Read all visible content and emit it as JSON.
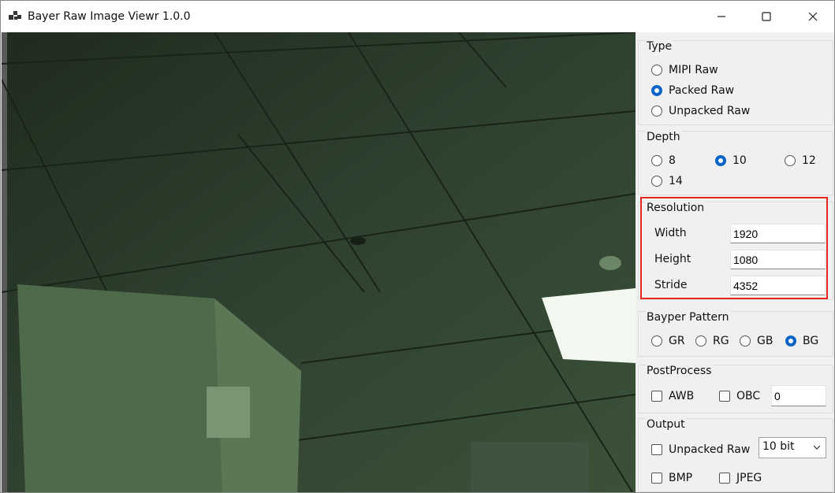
{
  "window": {
    "title": "Bayer Raw Image Viewr 1.0.0",
    "icon": "app-icon",
    "controls": [
      "minimize-icon",
      "maximize-icon",
      "close-icon"
    ]
  },
  "viewer": {
    "content": "green-tinted raw image of an office ceiling"
  },
  "type": {
    "title": "Type",
    "options": [
      {
        "label": "MIPI Raw",
        "selected": false
      },
      {
        "label": "Packed Raw",
        "selected": true
      },
      {
        "label": "Unpacked Raw",
        "selected": false
      }
    ]
  },
  "depth": {
    "title": "Depth",
    "options": [
      {
        "label": "8",
        "selected": false
      },
      {
        "label": "10",
        "selected": true
      },
      {
        "label": "12",
        "selected": false
      },
      {
        "label": "14",
        "selected": false
      }
    ]
  },
  "resolution": {
    "title": "Resolution",
    "width_label": "Width",
    "width_value": "1920",
    "height_label": "Height",
    "height_value": "1080",
    "stride_label": "Stride",
    "stride_value": "4352"
  },
  "bayer": {
    "title": "Bayper Pattern",
    "options": [
      {
        "label": "GR",
        "selected": false
      },
      {
        "label": "RG",
        "selected": false
      },
      {
        "label": "GB",
        "selected": false
      },
      {
        "label": "BG",
        "selected": true
      }
    ]
  },
  "postprocess": {
    "title": "PostProcess",
    "awb_label": "AWB",
    "awb_checked": false,
    "obc_label": "OBC",
    "obc_checked": false,
    "obc_value": "0"
  },
  "output": {
    "title": "Output",
    "unpacked_label": "Unpacked Raw",
    "unpacked_checked": false,
    "bit_value": "10 bit",
    "bmp_label": "BMP",
    "bmp_checked": false,
    "jpeg_label": "JPEG",
    "jpeg_checked": false
  },
  "colors": {
    "accent": "#0a63c5",
    "highlight": "#e52424",
    "image_base": "#2b3a27"
  }
}
